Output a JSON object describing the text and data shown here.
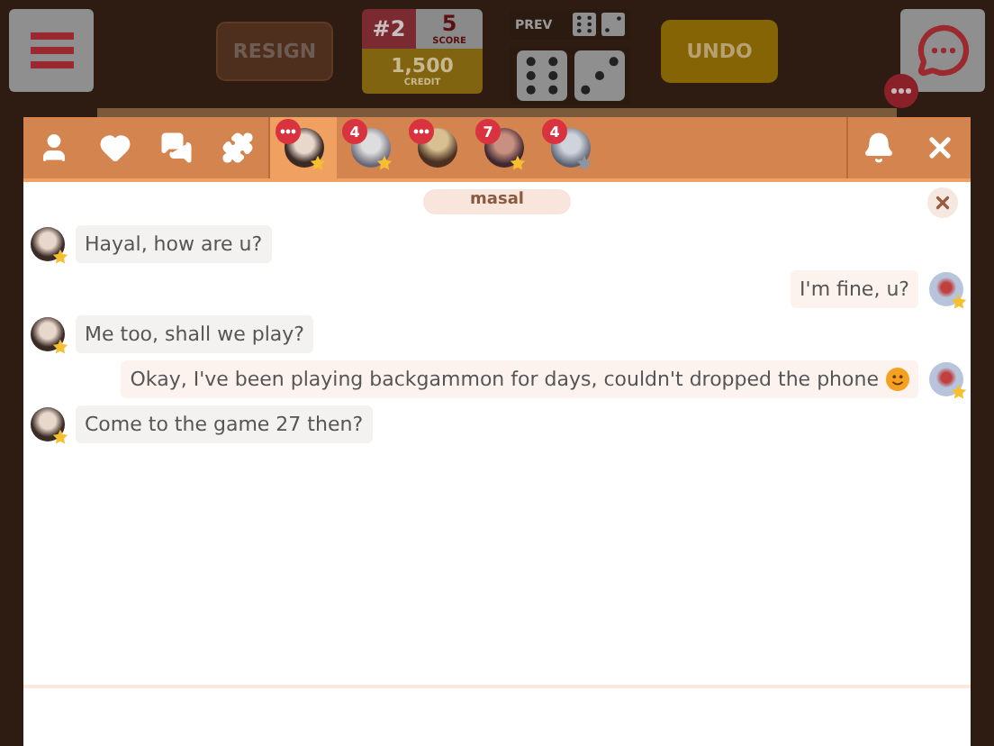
{
  "top_bar": {
    "resign": "RESIGN",
    "rank": "#2",
    "score": "5",
    "score_label": "SCORE",
    "credit": "1,500",
    "credit_label": "CREDIT",
    "prev_label": "PREV",
    "undo": "UNDO"
  },
  "chat_tabs": [
    {
      "kind": "typing",
      "selected": true,
      "has_star": true,
      "starred": true
    },
    {
      "kind": "count",
      "count": "4",
      "selected": false,
      "has_star": true,
      "starred": true
    },
    {
      "kind": "typing",
      "selected": false,
      "has_star": false
    },
    {
      "kind": "count",
      "count": "7",
      "selected": false,
      "has_star": true,
      "starred": true
    },
    {
      "kind": "count",
      "count": "4",
      "selected": false,
      "has_star": true,
      "starred": false
    }
  ],
  "conversation": {
    "name": "masal",
    "messages": [
      {
        "kind": "in",
        "text": "Hayal, how are u?"
      },
      {
        "kind": "out",
        "text": "I'm fine, u?"
      },
      {
        "kind": "in",
        "text": "Me too, shall we play?"
      },
      {
        "kind": "out",
        "text": "Okay, I've been playing backgammon for days, couldn't dropped the phone",
        "emoji": true
      },
      {
        "kind": "in",
        "text": "Come to the game 27 then?"
      }
    ]
  }
}
